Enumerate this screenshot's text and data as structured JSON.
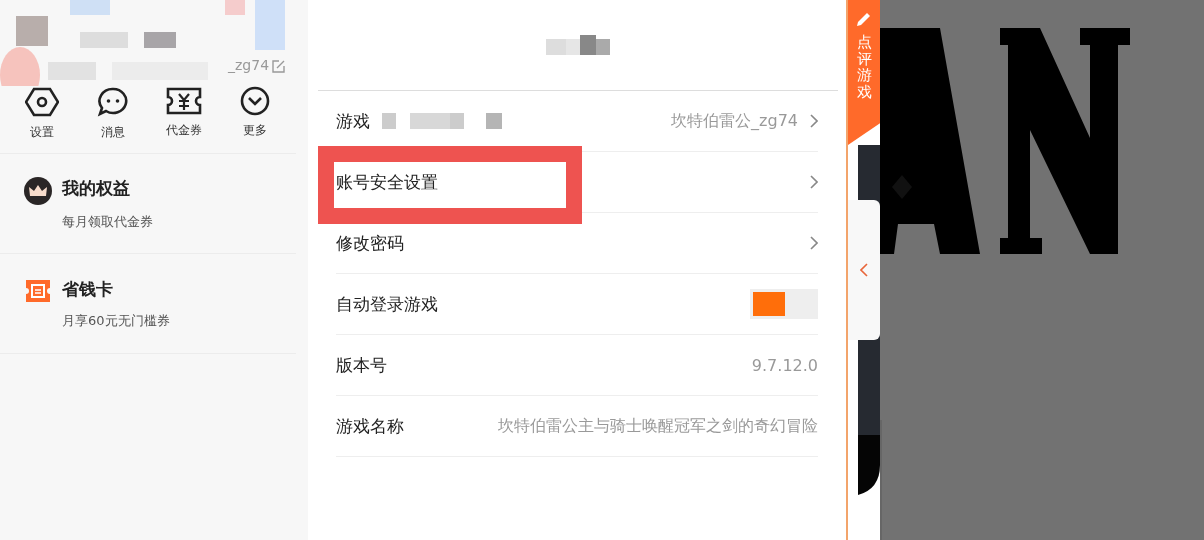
{
  "profile": {
    "handle": "_zg74"
  },
  "quick_actions": [
    {
      "label": "设置",
      "kind": "settings"
    },
    {
      "label": "消息",
      "kind": "message"
    },
    {
      "label": "代金券",
      "kind": "voucher"
    },
    {
      "label": "更多",
      "kind": "more"
    }
  ],
  "benefits": [
    {
      "title": "我的权益",
      "subtitle": "每月领取代金券",
      "kind": "crown"
    },
    {
      "title": "省钱卡",
      "subtitle": "月享60元无门槛券",
      "kind": "card"
    }
  ],
  "settings": {
    "rows": [
      {
        "label": "游戏",
        "value": "坎特伯雷公_zg74",
        "kind": "link",
        "masked": true
      },
      {
        "label": "账号安全设置",
        "kind": "link",
        "highlighted": true
      },
      {
        "label": "修改密码",
        "kind": "link"
      },
      {
        "label": "自动登录游戏",
        "kind": "toggle",
        "on": true
      },
      {
        "label": "版本号",
        "value": "9.7.12.0",
        "kind": "info"
      },
      {
        "label": "游戏名称",
        "value": "坎特伯雷公主与骑士唤醒冠军之剑的奇幻冒险",
        "kind": "info"
      }
    ]
  },
  "side_tab": {
    "label": "点评游戏"
  }
}
